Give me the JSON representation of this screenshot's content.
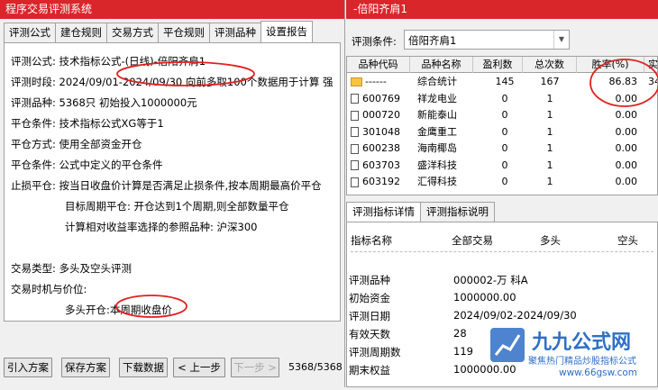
{
  "left_window": {
    "title": "程序交易评测系统",
    "tabs": [
      "评测公式",
      "建仓规则",
      "交易方式",
      "平仓规则",
      "评测品种",
      "设置报告"
    ],
    "lines": [
      "评测公式:  技术指标公式-(日线)-倍阳齐肩1",
      "评测时段:  2024/09/01-2024/09/30 向前多取100个数据用于计算 强",
      "评测品种:  5368只 初始投入1000000元",
      "平仓条件:  技术指标公式XG等于1",
      "平仓方式:  使用全部资金开仓",
      "平仓条件:  公式中定义的平仓条件",
      "止损平仓:  按当日收盘价计算是否满足止损条件,按本周期最高价平仓",
      "目标周期平仓:  开仓达到1个周期,则全部数量平仓",
      "计算相对收益率选择的参照品种:  沪深300",
      "交易类型:  多头及空头评测",
      "交易时机与价位:",
      "多头开仓:本周期收盘价"
    ],
    "buttons": [
      "引入方案",
      "保存方案",
      "下载数据",
      "< 上一步",
      "下一步 >"
    ],
    "counter": "5368/5368"
  },
  "right_window": {
    "title": "-倍阳齐肩1",
    "filter_label": "评测条件:",
    "filter_value": "倍阳齐肩1",
    "columns": [
      "品种代码",
      "品种名称",
      "盈利数",
      "总次数",
      "胜率(%)",
      "实"
    ],
    "rows": [
      {
        "code": "------",
        "name": "综合统计",
        "profit": "145",
        "total": "167",
        "win": "86.83",
        "extra": "34",
        "icon": "folder"
      },
      {
        "code": "600769",
        "name": "祥龙电业",
        "profit": "0",
        "total": "1",
        "win": "0.00",
        "extra": "",
        "icon": "doc"
      },
      {
        "code": "000720",
        "name": "新能泰山",
        "profit": "0",
        "total": "1",
        "win": "0.00",
        "extra": "",
        "icon": "doc"
      },
      {
        "code": "301048",
        "name": "金鹰重工",
        "profit": "0",
        "total": "1",
        "win": "0.00",
        "extra": "",
        "icon": "doc"
      },
      {
        "code": "600238",
        "name": "海南椰岛",
        "profit": "0",
        "total": "1",
        "win": "0.00",
        "extra": "",
        "icon": "doc"
      },
      {
        "code": "603703",
        "name": "盛洋科技",
        "profit": "0",
        "total": "1",
        "win": "0.00",
        "extra": "",
        "icon": "doc"
      },
      {
        "code": "603192",
        "name": "汇得科技",
        "profit": "0",
        "total": "1",
        "win": "0.00",
        "extra": "",
        "icon": "doc"
      }
    ],
    "detail_tabs": [
      "评测指标详情",
      "评测指标说明"
    ],
    "detail_header": [
      "指标名称",
      "全部交易",
      "多头",
      "空头"
    ],
    "detail_rows": [
      {
        "label": "评测品种",
        "value": "000002-万 科A"
      },
      {
        "label": "初始资金",
        "value": "1000000.00"
      },
      {
        "label": "评测日期",
        "value": "2024/09/02-2024/09/30"
      },
      {
        "label": "有效天数",
        "value": "28"
      },
      {
        "label": "评测周期数",
        "value": "119"
      },
      {
        "label": "期末权益",
        "value": "1000000.00"
      }
    ]
  },
  "watermark": {
    "brand": "九九公式网",
    "tagline": "聚焦热门精品炒股指标公式",
    "url": "www.66gsw.com"
  },
  "colors": {
    "title_bar": "#d9262b",
    "annotation": "#e02020",
    "brand_blue": "#2f6fc4"
  }
}
